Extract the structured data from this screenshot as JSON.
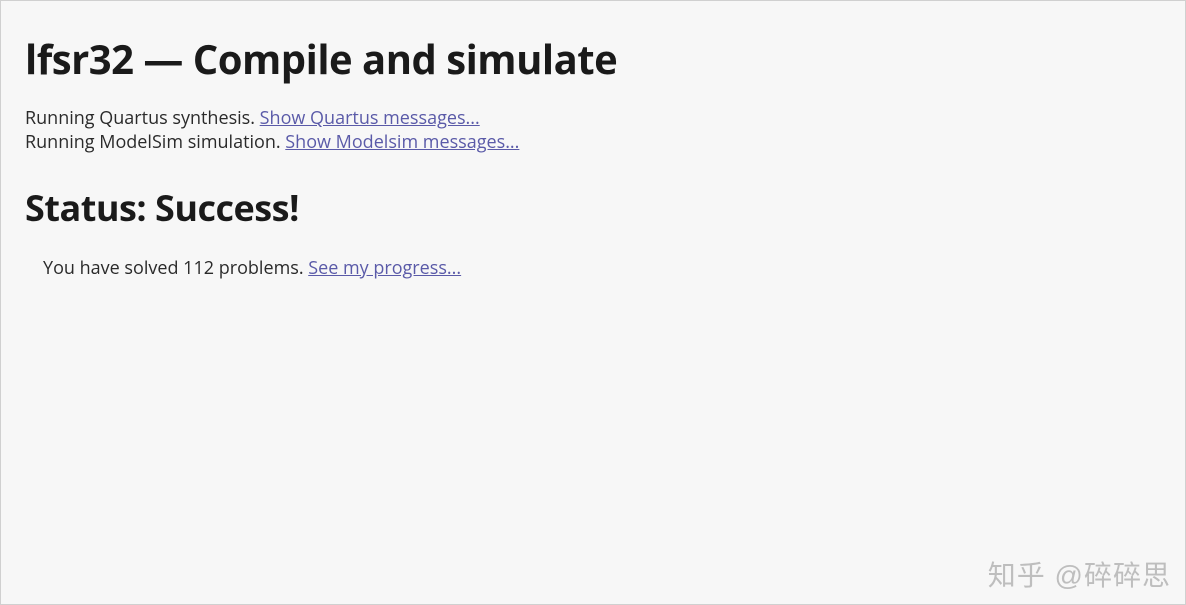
{
  "header": {
    "title": "lfsr32 — Compile and simulate"
  },
  "log": {
    "quartus_text": "Running Quartus synthesis. ",
    "quartus_link": "Show Quartus messages...",
    "modelsim_text": "Running ModelSim simulation. ",
    "modelsim_link": "Show Modelsim messages..."
  },
  "status": {
    "heading": "Status: Success!"
  },
  "progress": {
    "text": "You have solved 112 problems. ",
    "link": "See my progress..."
  },
  "watermark": "知乎 @碎碎思"
}
